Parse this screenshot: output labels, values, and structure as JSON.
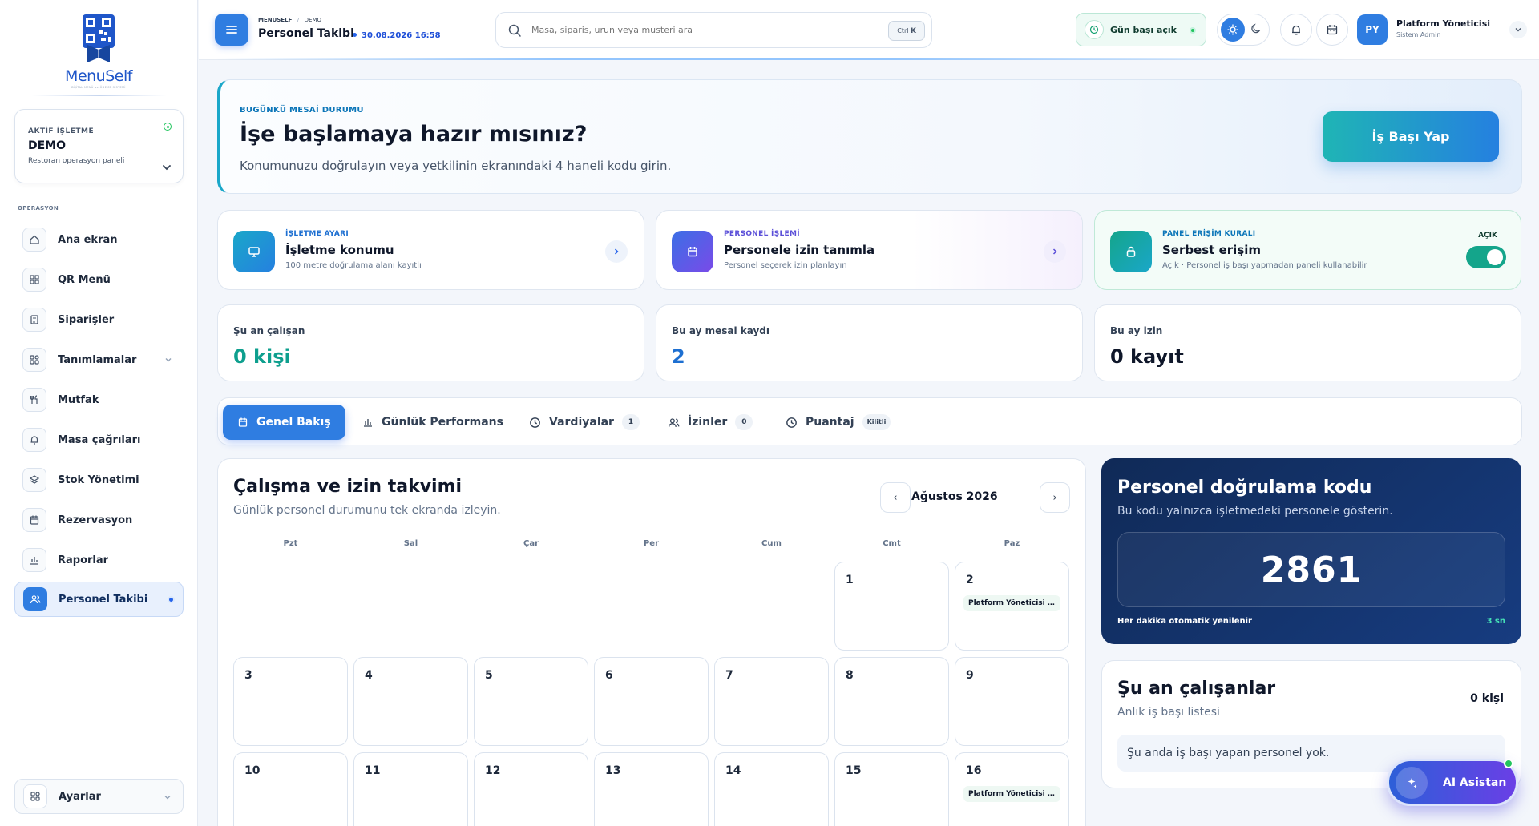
{
  "logo": {
    "word": "MenuSelf",
    "tagline": "DİJİTAL MENÜ ve ÖDEME SİSTEMİ"
  },
  "business": {
    "kicker": "AKTİF İŞLETME",
    "name": "DEMO",
    "subtitle": "Restoran operasyon paneli"
  },
  "sidebar": {
    "section_label": "OPERASYON",
    "items": [
      {
        "label": "Ana ekran",
        "icon": "home-icon"
      },
      {
        "label": "QR Menü",
        "icon": "grid-icon"
      },
      {
        "label": "Siparişler",
        "icon": "receipt-icon"
      },
      {
        "label": "Tanımlamalar",
        "icon": "settings-grid-icon"
      },
      {
        "label": "Mutfak",
        "icon": "utensils-icon"
      },
      {
        "label": "Masa çağrıları",
        "icon": "bell-icon"
      },
      {
        "label": "Stok Yönetimi",
        "icon": "layers-icon"
      },
      {
        "label": "Rezervasyon",
        "icon": "calendar-icon"
      },
      {
        "label": "Raporlar",
        "icon": "bar-chart-icon"
      },
      {
        "label": "Personel Takibi",
        "icon": "users-icon",
        "active": true
      }
    ],
    "settings_label": "Ayarlar"
  },
  "header": {
    "breadcrumb_root": "MENUSELF",
    "breadcrumb_sep": "/",
    "breadcrumb_leaf": "DEMO",
    "title": "Personel Takibi",
    "datetime": "30.08.2026 16:58",
    "search_placeholder": "Masa, siparis, urun veya musteri ara",
    "shortcut_mod": "Ctrl",
    "shortcut_key": "K",
    "shift_status": "Gün başı açık",
    "user_initials": "PY",
    "user_name": "Platform Yöneticisi",
    "user_role": "Sistem Admin"
  },
  "hero": {
    "kicker": "BUGÜNKÜ MESAİ DURUMU",
    "title": "İşe başlamaya hazır mısınız?",
    "subtitle": "Konumunuzu doğrulayın veya yetkilinin ekranındaki 4 haneli kodu girin.",
    "button": "İş Başı Yap"
  },
  "action_cards": [
    {
      "kicker": "İŞLETME AYARI",
      "title": "İşletme konumu",
      "subtitle": "100 metre doğrulama alanı kayıtlı"
    },
    {
      "kicker": "PERSONEL İŞLEMİ",
      "title": "Personele izin tanımla",
      "subtitle": "Personel seçerek izin planlayın"
    },
    {
      "kicker": "PANEL ERİŞİM KURALI",
      "title": "Serbest erişim",
      "subtitle": "Açık · Personel iş başı yapmadan paneli kullanabilir",
      "toggle_label": "AÇIK",
      "toggle_on": true
    }
  ],
  "stats": [
    {
      "label": "Şu an çalışan",
      "value": "0 kişi",
      "color": "#0e9f8e"
    },
    {
      "label": "Bu ay mesai kaydı",
      "value": "2",
      "color": "#1d6fd1"
    },
    {
      "label": "Bu ay izin",
      "value": "0 kayıt",
      "color": "#0f172a"
    }
  ],
  "tabs": [
    {
      "label": "Genel Bakış",
      "badge": ""
    },
    {
      "label": "Günlük Performans",
      "badge": ""
    },
    {
      "label": "Vardiyalar",
      "badge": "1"
    },
    {
      "label": "İzinler",
      "badge": "0"
    },
    {
      "label": "Puantaj",
      "badge": "Kilitli"
    }
  ],
  "calendar": {
    "title": "Çalışma ve izin takvimi",
    "subtitle": "Günlük personel durumunu tek ekranda izleyin.",
    "month": "Ağustos 2026",
    "prev": "‹",
    "next": "›",
    "weekdays": [
      "Pzt",
      "Sal",
      "Çar",
      "Per",
      "Cum",
      "Cmt",
      "Paz"
    ],
    "days": [
      {
        "n": "1",
        "event": ""
      },
      {
        "n": "2",
        "event": "Platform Yöneticisi …"
      },
      {
        "n": "3",
        "event": ""
      },
      {
        "n": "4",
        "event": ""
      },
      {
        "n": "5",
        "event": ""
      },
      {
        "n": "6",
        "event": ""
      },
      {
        "n": "7",
        "event": ""
      },
      {
        "n": "8",
        "event": ""
      },
      {
        "n": "9",
        "event": ""
      },
      {
        "n": "10",
        "event": ""
      },
      {
        "n": "11",
        "event": ""
      },
      {
        "n": "12",
        "event": ""
      },
      {
        "n": "13",
        "event": ""
      },
      {
        "n": "14",
        "event": ""
      },
      {
        "n": "15",
        "event": ""
      },
      {
        "n": "16",
        "event": "Platform Yöneticisi …"
      }
    ]
  },
  "code_card": {
    "title": "Personel doğrulama kodu",
    "subtitle": "Bu kodu yalnızca işletmedeki personele gösterin.",
    "code": "2861",
    "footer": "Her dakika otomatik yenilenir",
    "countdown": "3 sn"
  },
  "working": {
    "title": "Şu an çalışanlar",
    "subtitle": "Anlık iş başı listesi",
    "count": "0 kişi",
    "empty": "Şu anda iş başı yapan personel yok."
  },
  "ai_button": "AI Asistan"
}
